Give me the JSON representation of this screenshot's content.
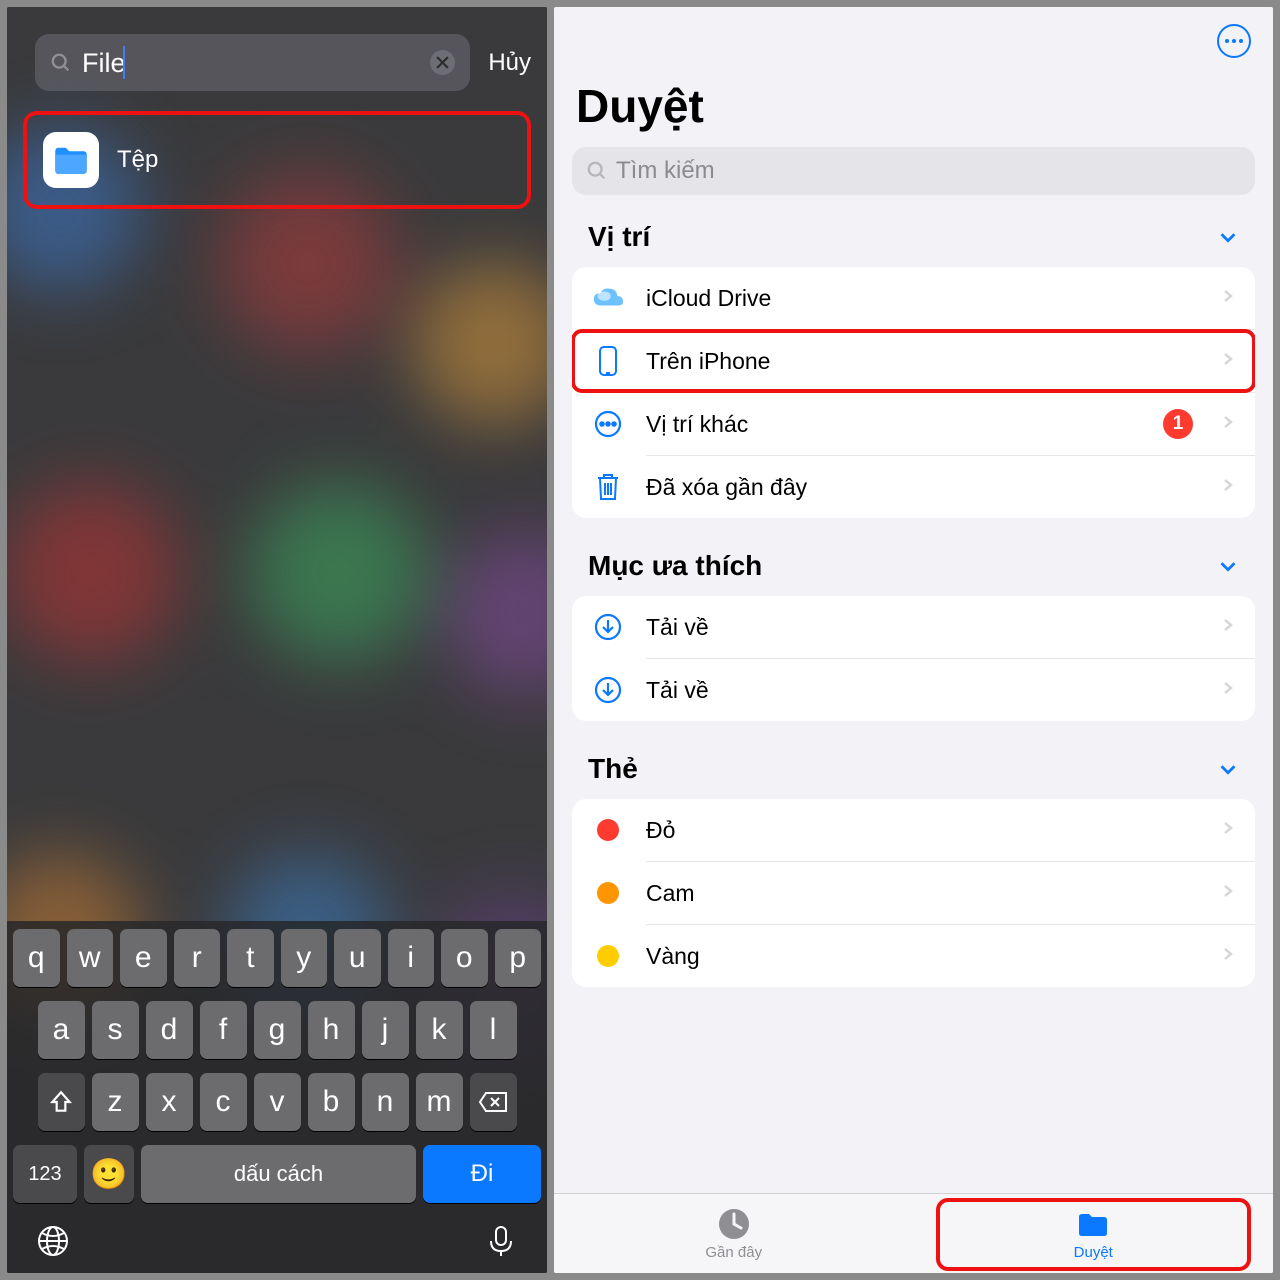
{
  "left": {
    "search_value": "File",
    "cancel_label": "Hủy",
    "result_label": "Tệp",
    "keyboard": {
      "row1": [
        "q",
        "w",
        "e",
        "r",
        "t",
        "y",
        "u",
        "i",
        "o",
        "p"
      ],
      "row2": [
        "a",
        "s",
        "d",
        "f",
        "g",
        "h",
        "j",
        "k",
        "l"
      ],
      "row3": [
        "z",
        "x",
        "c",
        "v",
        "b",
        "n",
        "m"
      ],
      "k123": "123",
      "space": "dấu cách",
      "go": "Đi"
    }
  },
  "right": {
    "page_title": "Duyệt",
    "search_placeholder": "Tìm kiếm",
    "sections": {
      "locations_title": "Vị trí",
      "icloud": "iCloud Drive",
      "on_iphone": "Trên iPhone",
      "other": "Vị trí khác",
      "other_badge": "1",
      "trash": "Đã xóa gần đây",
      "favorites_title": "Mục ưa thích",
      "download1": "Tải về",
      "download2": "Tải về",
      "tags_title": "Thẻ",
      "tag_red": "Đỏ",
      "tag_orange": "Cam",
      "tag_yellow": "Vàng"
    },
    "tabs": {
      "recent": "Gần đây",
      "browse": "Duyệt"
    }
  },
  "colors": {
    "accent": "#0a78ff",
    "highlight": "#e11",
    "tag_red": "#ff3b30",
    "tag_orange": "#ff9500",
    "tag_yellow": "#ffcc00"
  }
}
